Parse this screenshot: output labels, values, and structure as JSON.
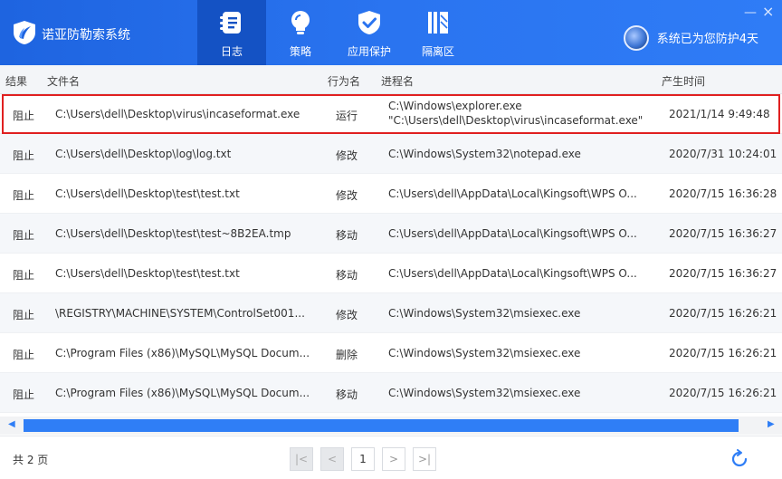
{
  "app": {
    "title": "诺亚防勒索系统",
    "protect_text": "系统已为您防护4天",
    "min_glyph": "—",
    "close_glyph": "×"
  },
  "nav": [
    {
      "label": "日志",
      "icon": "log-icon",
      "active": true
    },
    {
      "label": "策略",
      "icon": "bulb-icon",
      "active": false
    },
    {
      "label": "应用保护",
      "icon": "shield-icon",
      "active": false
    },
    {
      "label": "隔离区",
      "icon": "quarantine-icon",
      "active": false
    }
  ],
  "table": {
    "headers": [
      "结果",
      "文件名",
      "行为名",
      "进程名",
      "产生时间"
    ],
    "rows": [
      {
        "result": "阻止",
        "file": "C:\\Users\\dell\\Desktop\\virus\\incaseformat.exe",
        "action": "运行",
        "process": "C:\\Windows\\explorer.exe",
        "process2": "\"C:\\Users\\dell\\Desktop\\virus\\incaseformat.exe\"",
        "time": "2021/1/14 9:49:48"
      },
      {
        "result": "阻止",
        "file": "C:\\Users\\dell\\Desktop\\log\\log.txt",
        "action": "修改",
        "process": "C:\\Windows\\System32\\notepad.exe",
        "process2": "",
        "time": "2020/7/31 10:24:01"
      },
      {
        "result": "阻止",
        "file": "C:\\Users\\dell\\Desktop\\test\\test.txt",
        "action": "修改",
        "process": "C:\\Users\\dell\\AppData\\Local\\Kingsoft\\WPS O...",
        "process2": "",
        "time": "2020/7/15 16:36:28"
      },
      {
        "result": "阻止",
        "file": "C:\\Users\\dell\\Desktop\\test\\test~8B2EA.tmp",
        "action": "移动",
        "process": "C:\\Users\\dell\\AppData\\Local\\Kingsoft\\WPS O...",
        "process2": "",
        "time": "2020/7/15 16:36:27"
      },
      {
        "result": "阻止",
        "file": "C:\\Users\\dell\\Desktop\\test\\test.txt",
        "action": "移动",
        "process": "C:\\Users\\dell\\AppData\\Local\\Kingsoft\\WPS O...",
        "process2": "",
        "time": "2020/7/15 16:36:27"
      },
      {
        "result": "阻止",
        "file": "\\REGISTRY\\MACHINE\\SYSTEM\\ControlSet001...",
        "action": "修改",
        "process": "C:\\Windows\\System32\\msiexec.exe",
        "process2": "",
        "time": "2020/7/15 16:26:21"
      },
      {
        "result": "阻止",
        "file": "C:\\Program Files (x86)\\MySQL\\MySQL Docum...",
        "action": "删除",
        "process": "C:\\Windows\\System32\\msiexec.exe",
        "process2": "",
        "time": "2020/7/15 16:26:21"
      },
      {
        "result": "阻止",
        "file": "C:\\Program Files (x86)\\MySQL\\MySQL Docum...",
        "action": "移动",
        "process": "C:\\Windows\\System32\\msiexec.exe",
        "process2": "",
        "time": "2020/7/15 16:26:21"
      }
    ]
  },
  "scroll": {
    "left_arrow": "◀",
    "right_arrow": "▶"
  },
  "footer": {
    "pages_text": "共 2 页",
    "first_glyph": "|<",
    "prev_glyph": "<",
    "current_page": "1",
    "next_glyph": ">",
    "last_glyph": ">|"
  },
  "colors": {
    "accent": "#2f7ef6",
    "header": "#1e64e0",
    "highlight": "#e02020"
  }
}
